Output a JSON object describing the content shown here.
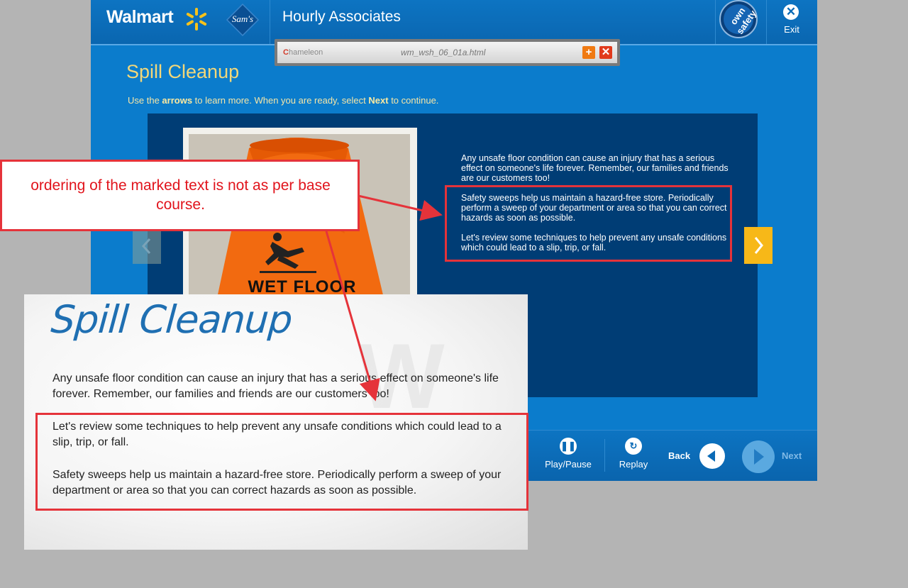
{
  "header": {
    "walmart_logo": "Walmart",
    "sams_logo": "Sam's",
    "sams_sub": "CLUB",
    "app_title": "Hourly Associates",
    "badge_text": "own safety",
    "exit_label": "Exit"
  },
  "chameleon": {
    "logo": "hameleon",
    "logo_letter": "C",
    "filename": "wm_wsh_06_01a.html"
  },
  "slide": {
    "title": "Spill Cleanup",
    "instruction_pre": "Use the ",
    "instruction_arrows": "arrows",
    "instruction_mid": " to learn more.  When you are ready, select ",
    "instruction_next": "Next",
    "instruction_post": " to continue.",
    "photo_sign": "WET FLOOR",
    "paragraph1": "Any unsafe floor condition can cause an injury that has a serious effect on someone's life forever.  Remember, our families and friends are our customers too!",
    "paragraph2": "Safety sweeps help us maintain a hazard-free store.  Periodically perform a sweep of your department or area so that you can correct hazards as soon as possible.",
    "paragraph3": "Let's review some techniques to help prevent any unsafe conditions which could lead to a slip, trip, or fall."
  },
  "controls": {
    "play_pause": "Play/Pause",
    "replay": "Replay",
    "back": "Back",
    "next": "Next"
  },
  "annotation": {
    "text": "ordering of the marked text is not as per base course."
  },
  "base_course": {
    "title": "Spill Cleanup",
    "paragraph1": "Any unsafe floor condition can cause an injury that has a serious effect on someone's life forever.  Remember, our families and friends are our customers too!",
    "paragraph2": "Let's review some techniques to help prevent any unsafe conditions which could lead to a slip, trip, or fall.",
    "paragraph3": "Safety sweeps help us maintain a hazard-free store.  Periodically perform a sweep of your department or area so that you can correct hazards as soon as possible."
  },
  "colors": {
    "walmart_blue": "#0b7ccc",
    "panel_navy": "#003d75",
    "accent_yellow": "#f7b818",
    "annotation_red": "#e5333a"
  }
}
